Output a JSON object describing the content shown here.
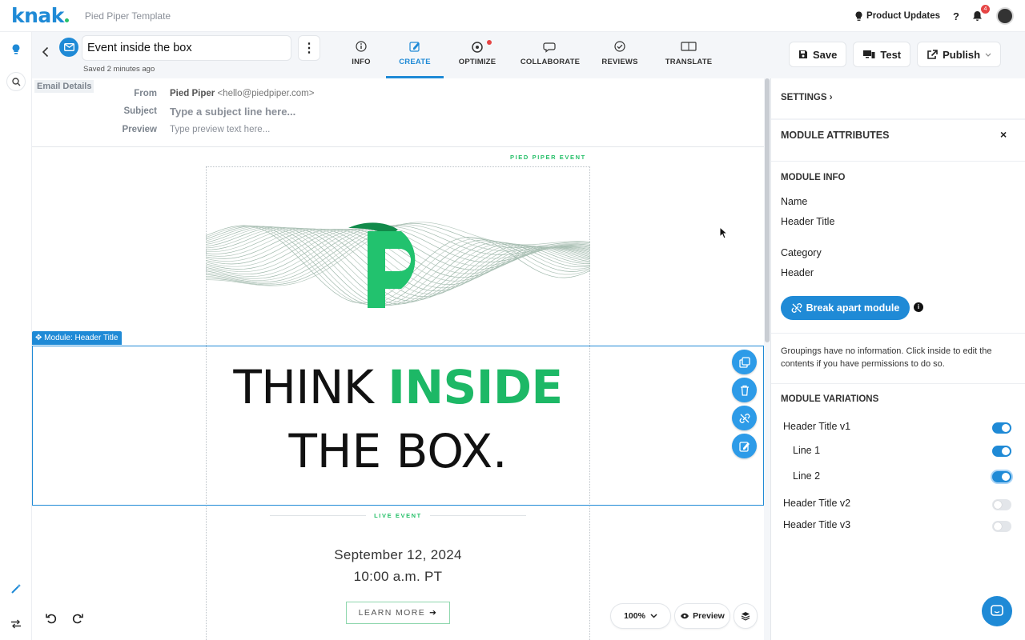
{
  "app": {
    "logo_text": "knak",
    "template_name": "Pied Piper Template",
    "brand_color": "#1f8ad6",
    "accent_green": "#1db866"
  },
  "topbar": {
    "product_updates": "Product Updates",
    "help": "?",
    "notifications_count": "4"
  },
  "editor": {
    "title": "Event inside the box",
    "saved_status": "Saved 2 minutes ago",
    "more": "⋮",
    "tabs": [
      {
        "label": "INFO",
        "icon": "info-icon"
      },
      {
        "label": "CREATE",
        "icon": "edit-icon",
        "active": true
      },
      {
        "label": "OPTIMIZE",
        "icon": "optimize-icon"
      },
      {
        "label": "COLLABORATE",
        "icon": "chat-icon"
      },
      {
        "label": "REVIEWS",
        "icon": "check-circle-icon"
      },
      {
        "label": "TRANSLATE",
        "icon": "translate-icon"
      }
    ],
    "actions": {
      "save": "Save",
      "test": "Test",
      "publish": "Publish"
    }
  },
  "email_details": {
    "tag": "Email Details",
    "from_label": "From",
    "from_name": "Pied Piper",
    "from_email": "<hello@piedpiper.com>",
    "subject_label": "Subject",
    "subject_placeholder": "Type a subject line here...",
    "preview_label": "Preview",
    "preview_placeholder": "Type preview text here..."
  },
  "email_body": {
    "event_tag": "PIED PIPER EVENT",
    "module_label": "Module: Header Title",
    "headline_plain": "THINK ",
    "headline_green": "INSIDE",
    "headline_line2": "THE BOX.",
    "live_event": "LIVE EVENT",
    "date": "September 12, 2024",
    "time": "10:00 a.m. PT",
    "cta": "LEARN MORE",
    "cta_arrow": "➔"
  },
  "canvas_tools": {
    "zoom": "100%",
    "preview": "Preview"
  },
  "panel": {
    "settings": "SETTINGS",
    "settings_chevron": "›",
    "module_attributes": "MODULE ATTRIBUTES",
    "close": "×",
    "module_info": "MODULE INFO",
    "name_label": "Name",
    "name_value": "Header Title",
    "category_label": "Category",
    "category_value": "Header",
    "break_apart": "Break apart module",
    "info": "i",
    "groupings_note": "Groupings have no information. Click inside to edit the contents if you have permissions to do so.",
    "variations_heading": "MODULE VARIATIONS",
    "variations": [
      {
        "label": "Header Title v1",
        "on": true
      },
      {
        "label": "Line 1",
        "on": true
      },
      {
        "label": "Line 2",
        "on": true
      },
      {
        "label": "Header Title v2",
        "on": false
      },
      {
        "label": "Header Title v3",
        "on": false
      }
    ]
  }
}
